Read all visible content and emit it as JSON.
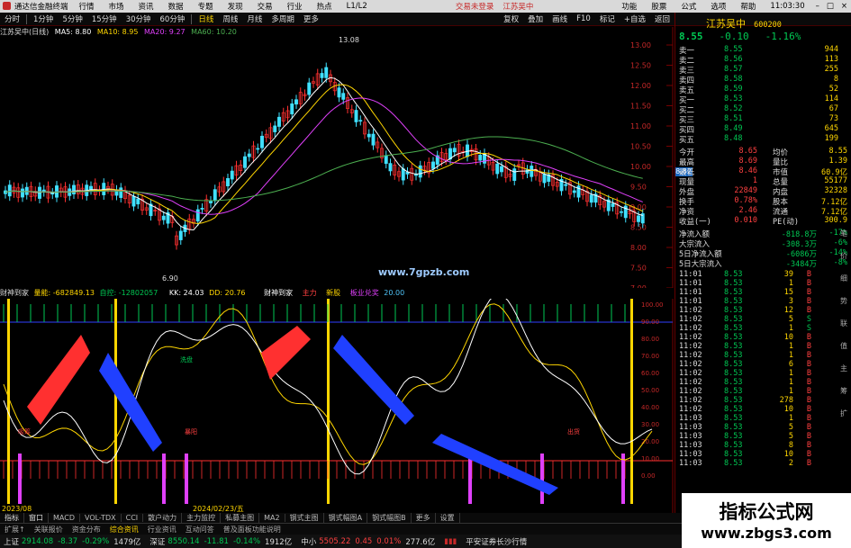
{
  "menu": {
    "title": "通达信金融终端",
    "items": [
      "行情",
      "市场",
      "资讯",
      "数据",
      "专题",
      "发现",
      "交易",
      "行业",
      "热点",
      "L1/L2"
    ],
    "center_links": [
      "交易未登录",
      "江苏吴中"
    ],
    "right_items": [
      "功能",
      "股票",
      "公式",
      "选项",
      "帮助"
    ],
    "clock": "11:03:30"
  },
  "toolbar": {
    "buttons": [
      "分时",
      "1分钟",
      "5分钟",
      "15分钟",
      "30分钟",
      "60分钟",
      "日线",
      "周线",
      "月线",
      "多周期",
      "更多"
    ],
    "active": "日线",
    "right": [
      "复权",
      "叠加",
      "画线",
      "F10",
      "标记",
      "+自选",
      "返回"
    ]
  },
  "main_info": {
    "name": "江苏吴中(日线)",
    "ma5": "MA5: 8.80",
    "ma10": "MA10: 8.95",
    "ma20": "MA20: 9.27",
    "ma60": "MA60: 10.20"
  },
  "y_axis": [
    "13.00",
    "12.50",
    "12.00",
    "11.50",
    "11.00",
    "10.50",
    "10.00",
    "9.50",
    "9.00",
    "8.50",
    "8.00",
    "7.50",
    "7.00"
  ],
  "price_marks": {
    "high": "13.08",
    "low": "6.90",
    "current": "8.82"
  },
  "watermark": "www.7gpzb.com",
  "sub_info": {
    "name": "财神到家",
    "vol": "量能: -682849.13",
    "mid": "自控: -12802057",
    "kk": "KK: 24.03",
    "dd": "DD: 20.76"
  },
  "sub_labels": {
    "a": "财神到家",
    "b": "主力",
    "c": "新股",
    "d": "板业兑奖",
    "e": "20.00"
  },
  "sub_axis": [
    "100.00",
    "90.00",
    "80.00",
    "70.00",
    "60.00",
    "50.00",
    "40.00",
    "30.00",
    "20.00",
    "10.00",
    "0.00"
  ],
  "markers": {
    "buy": "B",
    "sell": "S",
    "tag1": "吸筹",
    "tag2": "暴阳",
    "tag3": "出货",
    "tag4": "洗盘"
  },
  "x_dates": [
    "2023/08",
    "2024/02/23/五"
  ],
  "panel": {
    "name": "江苏吴中",
    "code": "600200",
    "price": "8.55",
    "change": "-0.10",
    "pct": "-1.16%",
    "asks": [
      {
        "l": "卖五",
        "p": "8.59",
        "v": "52"
      },
      {
        "l": "卖四",
        "p": "8.58",
        "v": "8"
      },
      {
        "l": "卖三",
        "p": "8.57",
        "v": "255"
      },
      {
        "l": "卖二",
        "p": "8.56",
        "v": "113"
      },
      {
        "l": "卖一",
        "p": "8.55",
        "v": "944"
      }
    ],
    "bids": [
      {
        "l": "买一",
        "p": "8.53",
        "v": "114"
      },
      {
        "l": "买二",
        "p": "8.52",
        "v": "67"
      },
      {
        "l": "买三",
        "p": "8.51",
        "v": "73"
      },
      {
        "l": "买四",
        "p": "8.49",
        "v": "645"
      },
      {
        "l": "买五",
        "p": "8.48",
        "v": "199"
      }
    ],
    "stats": [
      [
        "今开",
        "8.65",
        "均价",
        "8.55"
      ],
      [
        "最高",
        "8.69",
        "量比",
        "1.39"
      ],
      [
        "最低",
        "8.46",
        "市值",
        "60.9亿"
      ],
      [
        "现量",
        "1",
        "总量",
        "55177"
      ],
      [
        "外盘",
        "22849",
        "内盘",
        "32328"
      ],
      [
        "换手",
        "0.78%",
        "股本",
        "7.12亿"
      ],
      [
        "净资",
        "2.46",
        "流通",
        "7.12亿"
      ],
      [
        "收益(一)",
        "0.010",
        "PE(动)",
        "300.9"
      ]
    ],
    "flows": [
      [
        "净流入额",
        "-818.8万",
        "-17%"
      ],
      [
        "大宗流入",
        "-308.3万",
        "-6%"
      ],
      [
        "5日净流入额",
        "-6086万",
        "-14%"
      ],
      [
        "5日大宗流入",
        "-3484万",
        "-8%"
      ]
    ],
    "ticks": [
      [
        "11:01",
        "8.53",
        "39",
        "B"
      ],
      [
        "11:01",
        "8.53",
        "1",
        "B"
      ],
      [
        "11:01",
        "8.53",
        "15",
        "B"
      ],
      [
        "11:01",
        "8.53",
        "3",
        "B"
      ],
      [
        "11:02",
        "8.53",
        "12",
        "B"
      ],
      [
        "11:02",
        "8.53",
        "5",
        "S"
      ],
      [
        "11:02",
        "8.53",
        "1",
        "S"
      ],
      [
        "11:02",
        "8.53",
        "10",
        "B"
      ],
      [
        "11:02",
        "8.53",
        "1",
        "B"
      ],
      [
        "11:02",
        "8.53",
        "1",
        "B"
      ],
      [
        "11:02",
        "8.53",
        "6",
        "B"
      ],
      [
        "11:02",
        "8.53",
        "1",
        "B"
      ],
      [
        "11:02",
        "8.53",
        "1",
        "B"
      ],
      [
        "11:02",
        "8.53",
        "1",
        "B"
      ],
      [
        "11:02",
        "8.53",
        "278",
        "B"
      ],
      [
        "11:02",
        "8.53",
        "10",
        "B"
      ],
      [
        "11:03",
        "8.53",
        "1",
        "B"
      ],
      [
        "11:03",
        "8.53",
        "5",
        "B"
      ],
      [
        "11:03",
        "8.53",
        "5",
        "B"
      ],
      [
        "11:03",
        "8.53",
        "8",
        "B"
      ],
      [
        "11:03",
        "8.53",
        "10",
        "B"
      ],
      [
        "11:03",
        "8.53",
        "2",
        "B"
      ]
    ],
    "tabs": [
      "笔",
      "价",
      "细",
      "势",
      "联",
      "值",
      "主",
      "筹",
      "扩"
    ]
  },
  "bottom_tabs": [
    "指标",
    "窗口",
    "MACD",
    "VOL-TDX",
    "CCI",
    "散户动力",
    "主力监控",
    "私募主图",
    "MA2",
    "钢式主图",
    "钢式幅图A",
    "钢式幅图B",
    "更多",
    "设置"
  ],
  "bottom_tabs2": [
    "扩展↑",
    "关联报价",
    "资金分布",
    "综合资讯",
    "行业资讯",
    "互动问答",
    "普及面板功能说明"
  ],
  "status": {
    "sh": "上证",
    "sh_v": "2914.08",
    "sh_c": "-8.37",
    "sh_p": "-0.29%",
    "sh_a": "1479亿",
    "sz": "深证",
    "sz_v": "8550.14",
    "sz_c": "-11.81",
    "sz_p": "-0.14%",
    "sz_a": "1912亿",
    "zx": "中小",
    "zx_v": "5505.22",
    "zx_c": "0.45",
    "zx_p": "0.01%",
    "zx_a": "277.6亿",
    "broker": "平安证券长沙行情"
  },
  "promo": {
    "title": "指标公式网",
    "url": "www.zbgs3.com"
  },
  "colors": {
    "up": "#ff3030",
    "down": "#00e0ff",
    "ma": "#ffd600"
  }
}
